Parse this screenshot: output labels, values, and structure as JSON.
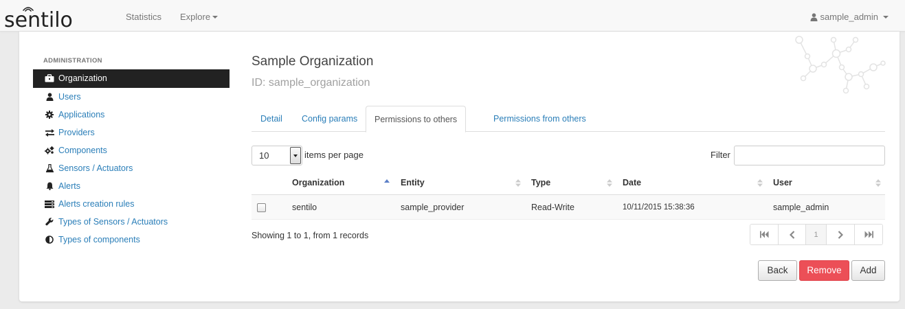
{
  "navbar": {
    "logo_text": "sentilo",
    "links": [
      "Statistics",
      "Explore"
    ],
    "user": "sample_admin"
  },
  "sidebar": {
    "header": "ADMINISTRATION",
    "items": [
      {
        "label": "Organization",
        "icon": "briefcase-icon",
        "active": true
      },
      {
        "label": "Users",
        "icon": "user-icon"
      },
      {
        "label": "Applications",
        "icon": "cog-icon"
      },
      {
        "label": "Providers",
        "icon": "exchange-icon"
      },
      {
        "label": "Components",
        "icon": "cogs-icon"
      },
      {
        "label": "Sensors / Actuators",
        "icon": "flask-icon"
      },
      {
        "label": "Alerts",
        "icon": "bell-icon"
      },
      {
        "label": "Alerts creation rules",
        "icon": "server-icon"
      },
      {
        "label": "Types of Sensors / Actuators",
        "icon": "wrench-icon"
      },
      {
        "label": "Types of components",
        "icon": "contrast-icon"
      }
    ]
  },
  "main": {
    "title": "Sample Organization",
    "id_label": "ID: sample_organization",
    "tabs": [
      "Detail",
      "Config params",
      "Permissions to others",
      "Permissions from others"
    ],
    "active_tab": "Permissions to others",
    "per_page": {
      "value": "10",
      "label": "items per page"
    },
    "filter": {
      "label": "Filter",
      "value": ""
    },
    "table": {
      "columns": [
        "Organization",
        "Entity",
        "Type",
        "Date",
        "User"
      ],
      "sorted_column": "Organization",
      "rows": [
        {
          "organization": "sentilo",
          "entity": "sample_provider",
          "type": "Read-Write",
          "date": "10/11/2015 15:38:36",
          "user": "sample_admin"
        }
      ]
    },
    "showing": "Showing 1 to 1, from 1 records",
    "pagination": {
      "current_page": "1"
    },
    "buttons": {
      "back": "Back",
      "remove": "Remove",
      "add": "Add"
    }
  },
  "colors": {
    "link": "#2a7eb8",
    "active_nav": "#222222",
    "danger": "#ec4f57",
    "sort_active": "#5b7fc7"
  }
}
